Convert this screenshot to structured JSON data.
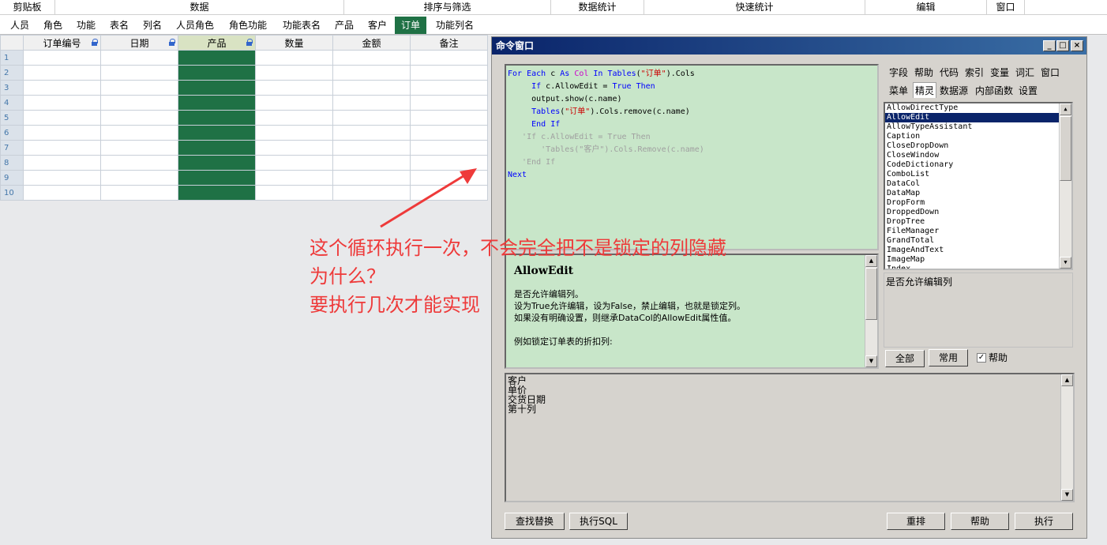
{
  "ribbon_groups": [
    "剪贴板",
    "数据",
    "排序与筛选",
    "数据统计",
    "快速统计",
    "编辑",
    "窗口"
  ],
  "tabs": [
    {
      "label": "人员",
      "active": false
    },
    {
      "label": "角色",
      "active": false
    },
    {
      "label": "功能",
      "active": false
    },
    {
      "label": "表名",
      "active": false
    },
    {
      "label": "列名",
      "active": false
    },
    {
      "label": "人员角色",
      "active": false
    },
    {
      "label": "角色功能",
      "active": false
    },
    {
      "label": "功能表名",
      "active": false
    },
    {
      "label": "产品",
      "active": false
    },
    {
      "label": "客户",
      "active": false
    },
    {
      "label": "订单",
      "active": true
    },
    {
      "label": "功能列名",
      "active": false
    }
  ],
  "grid": {
    "columns": [
      {
        "label": "订单编号",
        "locked": true
      },
      {
        "label": "日期",
        "locked": true
      },
      {
        "label": "产品",
        "locked": true
      },
      {
        "label": "数量",
        "locked": false
      },
      {
        "label": "金额",
        "locked": false
      },
      {
        "label": "备注",
        "locked": false
      }
    ],
    "row_numbers": [
      "1",
      "2",
      "3",
      "4",
      "5",
      "6",
      "7",
      "8",
      "9",
      "10"
    ],
    "selected_column": "产品"
  },
  "annotation": {
    "line1": "这个循环执行一次，不会完全把不是锁定的列隐藏",
    "line2": "为什么？",
    "line3": "要执行几次才能实现",
    "color": "#ee3a3a"
  },
  "command_window": {
    "title": "命令窗口",
    "code_lines": [
      "For Each c As Col In Tables(\"订单\").Cols",
      "    If c.AllowEdit = True Then",
      "    output.show(c.name)",
      "    Tables(\"订单\").Cols.remove(c.name)",
      "    End If",
      "   'If c.AllowEdit = True Then",
      "       'Tables(\"客户\").Cols.Remove(c.name)",
      "   'End If",
      "Next"
    ],
    "doc_title": "AllowEdit",
    "doc_lines": [
      "是否允许编辑列。",
      "设为True允许编辑，设为False，禁止编辑，也就是锁定列。",
      "如果没有明确设置，则继承DataCol的AllowEdit属性值。",
      "",
      "例如锁定订单表的折扣列:"
    ],
    "tabs_row1": [
      "字段",
      "帮助",
      "代码",
      "索引",
      "变量",
      "词汇",
      "窗口"
    ],
    "tabs_row2": [
      "菜单",
      "精灵",
      "数据源",
      "内部函数",
      "设置"
    ],
    "selected_tab": "精灵",
    "property_list": [
      "AllowDirectType",
      "AllowEdit",
      "AllowTypeAssistant",
      "Caption",
      "CloseDropDown",
      "CloseWindow",
      "CodeDictionary",
      "ComboList",
      "DataCol",
      "DataMap",
      "DropForm",
      "DroppedDown",
      "DropTree",
      "FileManager",
      "GrandTotal",
      "ImageAndText",
      "ImageMap",
      "Index"
    ],
    "selected_property": "AllowEdit",
    "property_description": "是否允许编辑列",
    "filter_buttons": {
      "all": "全部",
      "common": "常用",
      "help_checkbox": "帮助",
      "help_checked": true
    },
    "output_lines": [
      "客户",
      "单价",
      "交货日期",
      "第十列"
    ],
    "bottom_buttons": {
      "find_replace": "查找替换",
      "exec_sql": "执行SQL",
      "rearrange": "重排",
      "help": "帮助",
      "execute": "执行"
    }
  }
}
